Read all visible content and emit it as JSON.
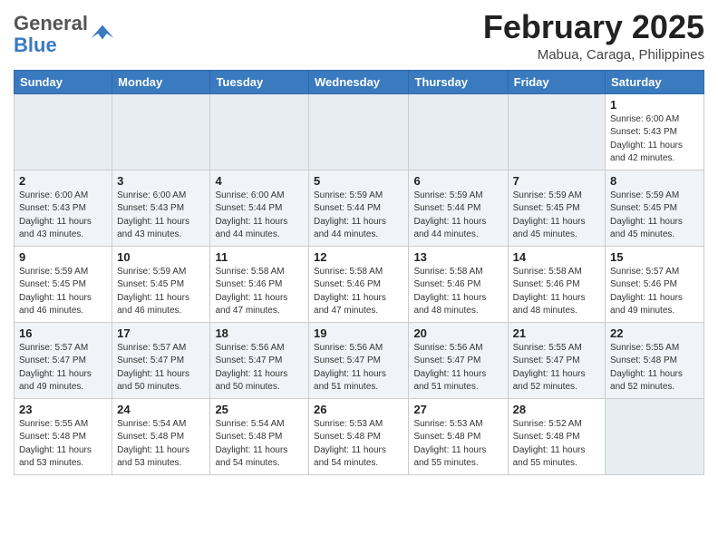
{
  "header": {
    "logo_general": "General",
    "logo_blue": "Blue",
    "month_year": "February 2025",
    "location": "Mabua, Caraga, Philippines"
  },
  "days_of_week": [
    "Sunday",
    "Monday",
    "Tuesday",
    "Wednesday",
    "Thursday",
    "Friday",
    "Saturday"
  ],
  "weeks": [
    {
      "days": [
        {
          "num": "",
          "info": ""
        },
        {
          "num": "",
          "info": ""
        },
        {
          "num": "",
          "info": ""
        },
        {
          "num": "",
          "info": ""
        },
        {
          "num": "",
          "info": ""
        },
        {
          "num": "",
          "info": ""
        },
        {
          "num": "1",
          "info": "Sunrise: 6:00 AM\nSunset: 5:43 PM\nDaylight: 11 hours\nand 42 minutes."
        }
      ]
    },
    {
      "days": [
        {
          "num": "2",
          "info": "Sunrise: 6:00 AM\nSunset: 5:43 PM\nDaylight: 11 hours\nand 43 minutes."
        },
        {
          "num": "3",
          "info": "Sunrise: 6:00 AM\nSunset: 5:43 PM\nDaylight: 11 hours\nand 43 minutes."
        },
        {
          "num": "4",
          "info": "Sunrise: 6:00 AM\nSunset: 5:44 PM\nDaylight: 11 hours\nand 44 minutes."
        },
        {
          "num": "5",
          "info": "Sunrise: 5:59 AM\nSunset: 5:44 PM\nDaylight: 11 hours\nand 44 minutes."
        },
        {
          "num": "6",
          "info": "Sunrise: 5:59 AM\nSunset: 5:44 PM\nDaylight: 11 hours\nand 44 minutes."
        },
        {
          "num": "7",
          "info": "Sunrise: 5:59 AM\nSunset: 5:45 PM\nDaylight: 11 hours\nand 45 minutes."
        },
        {
          "num": "8",
          "info": "Sunrise: 5:59 AM\nSunset: 5:45 PM\nDaylight: 11 hours\nand 45 minutes."
        }
      ]
    },
    {
      "days": [
        {
          "num": "9",
          "info": "Sunrise: 5:59 AM\nSunset: 5:45 PM\nDaylight: 11 hours\nand 46 minutes."
        },
        {
          "num": "10",
          "info": "Sunrise: 5:59 AM\nSunset: 5:45 PM\nDaylight: 11 hours\nand 46 minutes."
        },
        {
          "num": "11",
          "info": "Sunrise: 5:58 AM\nSunset: 5:46 PM\nDaylight: 11 hours\nand 47 minutes."
        },
        {
          "num": "12",
          "info": "Sunrise: 5:58 AM\nSunset: 5:46 PM\nDaylight: 11 hours\nand 47 minutes."
        },
        {
          "num": "13",
          "info": "Sunrise: 5:58 AM\nSunset: 5:46 PM\nDaylight: 11 hours\nand 48 minutes."
        },
        {
          "num": "14",
          "info": "Sunrise: 5:58 AM\nSunset: 5:46 PM\nDaylight: 11 hours\nand 48 minutes."
        },
        {
          "num": "15",
          "info": "Sunrise: 5:57 AM\nSunset: 5:46 PM\nDaylight: 11 hours\nand 49 minutes."
        }
      ]
    },
    {
      "days": [
        {
          "num": "16",
          "info": "Sunrise: 5:57 AM\nSunset: 5:47 PM\nDaylight: 11 hours\nand 49 minutes."
        },
        {
          "num": "17",
          "info": "Sunrise: 5:57 AM\nSunset: 5:47 PM\nDaylight: 11 hours\nand 50 minutes."
        },
        {
          "num": "18",
          "info": "Sunrise: 5:56 AM\nSunset: 5:47 PM\nDaylight: 11 hours\nand 50 minutes."
        },
        {
          "num": "19",
          "info": "Sunrise: 5:56 AM\nSunset: 5:47 PM\nDaylight: 11 hours\nand 51 minutes."
        },
        {
          "num": "20",
          "info": "Sunrise: 5:56 AM\nSunset: 5:47 PM\nDaylight: 11 hours\nand 51 minutes."
        },
        {
          "num": "21",
          "info": "Sunrise: 5:55 AM\nSunset: 5:47 PM\nDaylight: 11 hours\nand 52 minutes."
        },
        {
          "num": "22",
          "info": "Sunrise: 5:55 AM\nSunset: 5:48 PM\nDaylight: 11 hours\nand 52 minutes."
        }
      ]
    },
    {
      "days": [
        {
          "num": "23",
          "info": "Sunrise: 5:55 AM\nSunset: 5:48 PM\nDaylight: 11 hours\nand 53 minutes."
        },
        {
          "num": "24",
          "info": "Sunrise: 5:54 AM\nSunset: 5:48 PM\nDaylight: 11 hours\nand 53 minutes."
        },
        {
          "num": "25",
          "info": "Sunrise: 5:54 AM\nSunset: 5:48 PM\nDaylight: 11 hours\nand 54 minutes."
        },
        {
          "num": "26",
          "info": "Sunrise: 5:53 AM\nSunset: 5:48 PM\nDaylight: 11 hours\nand 54 minutes."
        },
        {
          "num": "27",
          "info": "Sunrise: 5:53 AM\nSunset: 5:48 PM\nDaylight: 11 hours\nand 55 minutes."
        },
        {
          "num": "28",
          "info": "Sunrise: 5:52 AM\nSunset: 5:48 PM\nDaylight: 11 hours\nand 55 minutes."
        },
        {
          "num": "",
          "info": ""
        }
      ]
    }
  ]
}
